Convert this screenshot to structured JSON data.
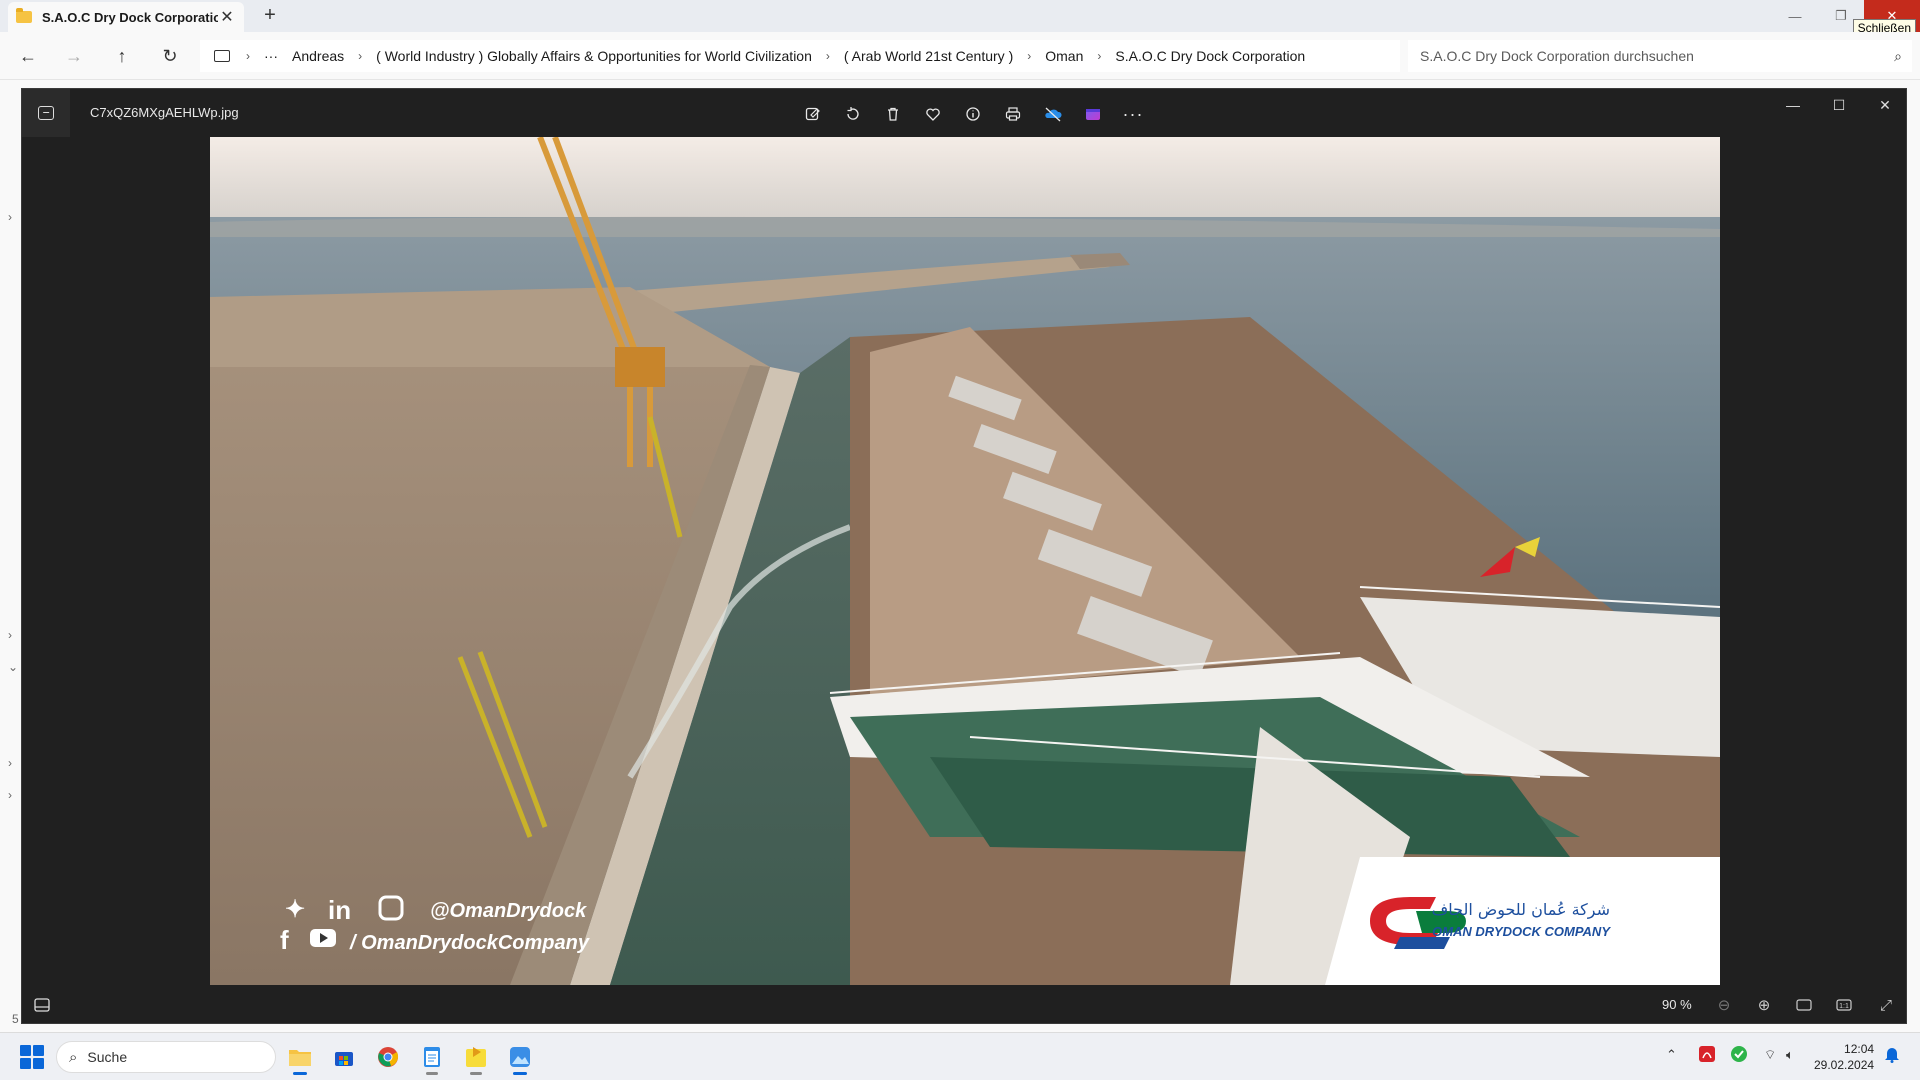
{
  "explorer": {
    "tab_title": "S.A.O.C Dry Dock Corporation",
    "tooltip": "Schließen",
    "breadcrumb": [
      "Andreas",
      "( World Industry ) Globally Affairs & Opportunities for World Civilization",
      "( Arab World 21st Century )",
      "Oman",
      "S.A.O.C Dry Dock Corporation"
    ],
    "search_placeholder": "S.A.O.C Dry Dock Corporation durchsuchen",
    "status_fragment": "5"
  },
  "viewer": {
    "filename": "C7xQZ6MXgAEHLWp.jpg",
    "toolbar": [
      "edit-image",
      "rotate",
      "delete",
      "favorite",
      "file-info",
      "print",
      "onedrive",
      "clipchamp",
      "more"
    ],
    "zoom": "90 %"
  },
  "photo": {
    "social_handle": "@OmanDrydock",
    "social_channel": "/ OmanDrydockCompany",
    "logo_arabic": "شركة عُمان للحوض الجاف",
    "logo_english": "OMAN DRYDOCK COMPANY"
  },
  "taskbar": {
    "search_label": "Suche",
    "time": "12:04",
    "date": "29.02.2024"
  },
  "colors": {
    "accent": "#0a67d8",
    "close": "#c42b1c",
    "viewer_bg": "#202020",
    "logo_red": "#d8232a",
    "logo_green": "#0a7d3c",
    "logo_blue": "#1d4f9e"
  }
}
